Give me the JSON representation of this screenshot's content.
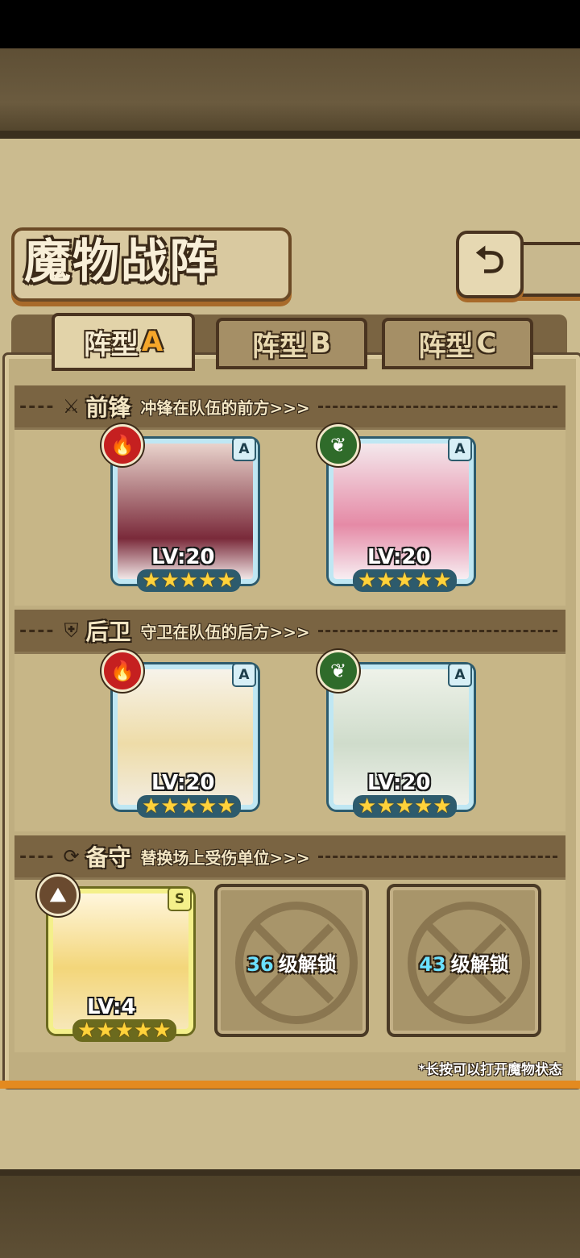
{
  "title": "魔物战阵",
  "tabs": [
    {
      "prefix": "阵型",
      "letter": "A",
      "active": true
    },
    {
      "prefix": "阵型",
      "letter": "B",
      "active": false
    },
    {
      "prefix": "阵型",
      "letter": "C",
      "active": false
    }
  ],
  "sections": {
    "front": {
      "name": "前锋",
      "desc": "冲锋在队伍的前方>>>",
      "icon": "sword-icon"
    },
    "rear": {
      "name": "后卫",
      "desc": "守卫在队伍的后方>>>",
      "icon": "shield-icon"
    },
    "reserve": {
      "name": "备守",
      "desc": "替换场上受伤单位>>>",
      "icon": "swap-icon"
    }
  },
  "front_cards": [
    {
      "element": "fire",
      "rank": "A",
      "level": "LV:20",
      "stars": 5
    },
    {
      "element": "leaf",
      "rank": "A",
      "level": "LV:20",
      "stars": 5
    }
  ],
  "rear_cards": [
    {
      "element": "fire",
      "rank": "A",
      "level": "LV:20",
      "stars": 5
    },
    {
      "element": "leaf",
      "rank": "A",
      "level": "LV:20",
      "stars": 5
    }
  ],
  "reserve_card": {
    "element": "earth",
    "rank": "S",
    "level": "LV:4",
    "stars": 5
  },
  "locked_slots": [
    {
      "level": "36",
      "text": "级解锁"
    },
    {
      "level": "43",
      "text": "级解锁"
    }
  ],
  "hint": "*长按可以打开魔物状态",
  "colors": {
    "accent": "#f5a62a",
    "fire": "#c52020",
    "leaf": "#2f6b2a",
    "unlock_number": "#6be0ff"
  }
}
